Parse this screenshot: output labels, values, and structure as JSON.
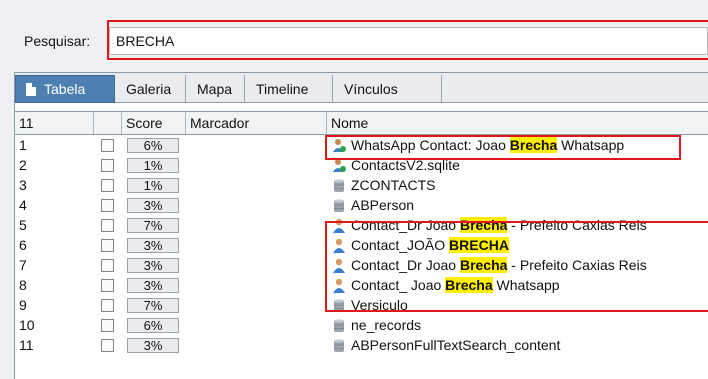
{
  "search": {
    "label": "Pesquisar:",
    "value": "BRECHA"
  },
  "tabs": [
    {
      "label": "Tabela",
      "active": true
    },
    {
      "label": "Galeria"
    },
    {
      "label": "Mapa"
    },
    {
      "label": "Timeline"
    },
    {
      "label": "Vínculos"
    }
  ],
  "columns": {
    "count": "11",
    "score": "Score",
    "marker": "Marcador",
    "name": "Nome"
  },
  "rows": [
    {
      "num": "1",
      "score": "6%",
      "icon": "contact-icon",
      "pre": "WhatsApp Contact: Joao ",
      "hit": "Brecha",
      "post": " Whatsapp"
    },
    {
      "num": "2",
      "score": "1%",
      "icon": "contact-icon",
      "pre": "ContactsV2.sqlite",
      "hit": "",
      "post": ""
    },
    {
      "num": "3",
      "score": "1%",
      "icon": "database-icon",
      "pre": "ZCONTACTS",
      "hit": "",
      "post": ""
    },
    {
      "num": "4",
      "score": "3%",
      "icon": "database-icon",
      "pre": "ABPerson",
      "hit": "",
      "post": ""
    },
    {
      "num": "5",
      "score": "7%",
      "icon": "person-icon",
      "pre": "Contact_Dr Joao ",
      "hit": "Brecha",
      "post": " - Prefeito Caxias Reis"
    },
    {
      "num": "6",
      "score": "3%",
      "icon": "person-icon",
      "pre": "Contact_JOÃO ",
      "hit": "BRECHA",
      "post": ""
    },
    {
      "num": "7",
      "score": "3%",
      "icon": "person-icon",
      "pre": "Contact_Dr Joao ",
      "hit": "Brecha",
      "post": " - Prefeito Caxias Reis"
    },
    {
      "num": "8",
      "score": "3%",
      "icon": "person-icon",
      "pre": "Contact_ Joao ",
      "hit": "Brecha",
      "post": " Whatsapp"
    },
    {
      "num": "9",
      "score": "7%",
      "icon": "database-icon",
      "pre": "Versiculo",
      "hit": "",
      "post": ""
    },
    {
      "num": "10",
      "score": "6%",
      "icon": "database-icon",
      "pre": "ne_records",
      "hit": "",
      "post": ""
    },
    {
      "num": "11",
      "score": "3%",
      "icon": "database-icon",
      "pre": "ABPersonFullTextSearch_content",
      "hit": "",
      "post": ""
    }
  ],
  "colors": {
    "highlight": "#ffee00",
    "annotation": "#e0161b",
    "tab_active": "#4d7fb0"
  }
}
